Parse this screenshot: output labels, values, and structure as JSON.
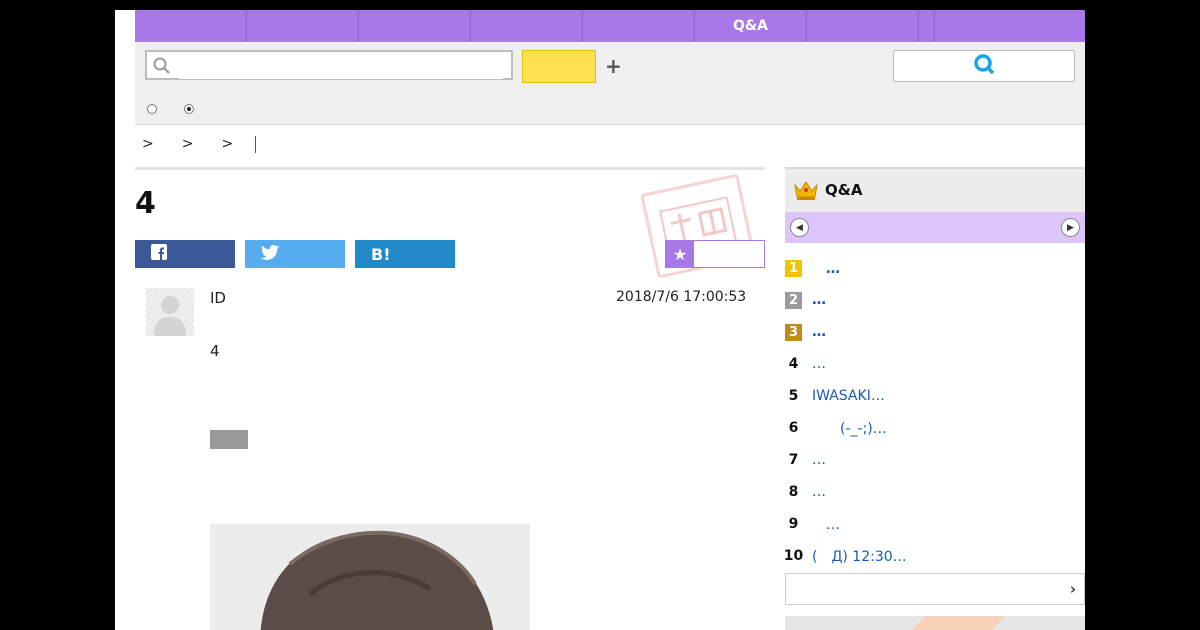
{
  "nav": {
    "items": [
      "",
      "",
      "",
      "",
      "",
      "Q&A",
      "",
      "",
      ""
    ]
  },
  "search": {
    "placeholder": "",
    "value": ""
  },
  "breadcrumb": [
    ">",
    ">",
    ">"
  ],
  "question": {
    "title": "4",
    "user_id": "ID",
    "date": "2018/7/6  17:00:53",
    "body": "4"
  },
  "share": {
    "twitter_label": "",
    "hatena_label": "B!"
  },
  "sidebar": {
    "title": "Q&A",
    "ranking": [
      {
        "rank": "1",
        "text": "　…"
      },
      {
        "rank": "2",
        "text": "…"
      },
      {
        "rank": "3",
        "text": "…"
      },
      {
        "rank": "4",
        "text": "…"
      },
      {
        "rank": "5",
        "text": "IWASAKI…"
      },
      {
        "rank": "6",
        "text": "　　(-_-;)…"
      },
      {
        "rank": "7",
        "text": "…"
      },
      {
        "rank": "8",
        "text": "…"
      },
      {
        "rank": "9",
        "text": "　…"
      },
      {
        "rank": "10",
        "text": "(　Д) 12:30…"
      }
    ]
  },
  "colors": {
    "nav": "#a877e8",
    "search_button": "#ffe14d",
    "facebook": "#3b5998",
    "twitter": "#55acee",
    "hatena": "#2289c9",
    "link": "#1a5bb5"
  }
}
